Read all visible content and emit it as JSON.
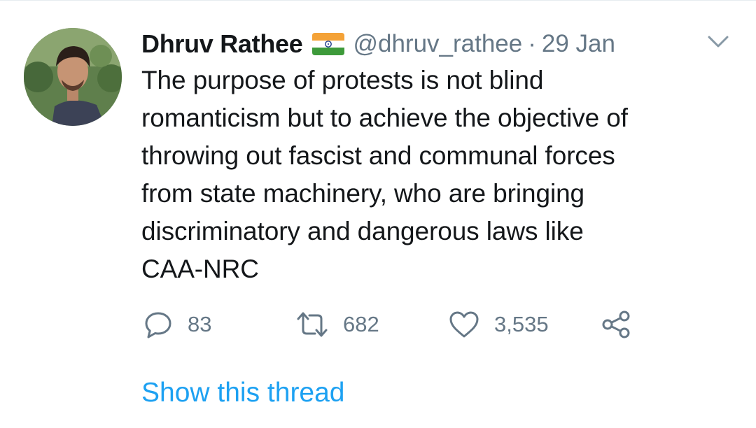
{
  "tweet": {
    "author": {
      "display_name": "Dhruv Rathee",
      "handle": "@dhruv_rathee",
      "flag": "india-flag-icon"
    },
    "separator": "·",
    "timestamp": "29 Jan",
    "text_lines": [
      "The purpose of protests is not blind",
      "romanticism but to achieve the objective of",
      "throwing out fascist and communal forces",
      "from state machinery, who are bringing",
      "discriminatory and dangerous laws like",
      "CAA-NRC"
    ],
    "actions": {
      "reply_count": "83",
      "retweet_count": "682",
      "like_count": "3,535"
    },
    "show_thread_label": "Show this thread"
  },
  "icons": {
    "reply": "reply-icon",
    "retweet": "retweet-icon",
    "like": "heart-icon",
    "share": "share-icon",
    "more": "chevron-down-icon"
  },
  "colors": {
    "text_primary": "#14171a",
    "text_secondary": "#657786",
    "link": "#1da1f2",
    "divider": "#e6ecf0"
  }
}
